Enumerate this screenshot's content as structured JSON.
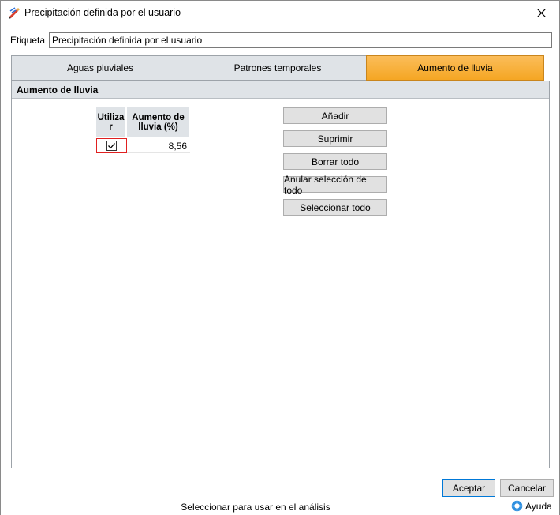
{
  "window": {
    "title": "Precipitación definida por el usuario"
  },
  "etiqueta": {
    "label": "Etiqueta",
    "value": "Precipitación definida por el usuario"
  },
  "tabs": [
    {
      "label": "Aguas pluviales",
      "active": false
    },
    {
      "label": "Patrones temporales",
      "active": false
    },
    {
      "label": "Aumento de lluvia",
      "active": true
    }
  ],
  "section": {
    "title": "Aumento de lluvia"
  },
  "grid": {
    "col_use": "Utiliza\nr",
    "col_value": "Aumento de\nlluvia (%)",
    "rows": [
      {
        "checked": true,
        "value": "8,56"
      }
    ]
  },
  "buttons": {
    "add": "Añadir",
    "delete": "Suprimir",
    "clear_all": "Borrar todo",
    "deselect_all": "Anular selección de todo",
    "select_all": "Seleccionar todo"
  },
  "footer": {
    "ok": "Aceptar",
    "cancel": "Cancelar"
  },
  "status": {
    "text": "Seleccionar para usar en el análisis",
    "help": "Ayuda"
  },
  "colors": {
    "active_tab": "#f5a623",
    "highlight_border": "#e02020"
  }
}
